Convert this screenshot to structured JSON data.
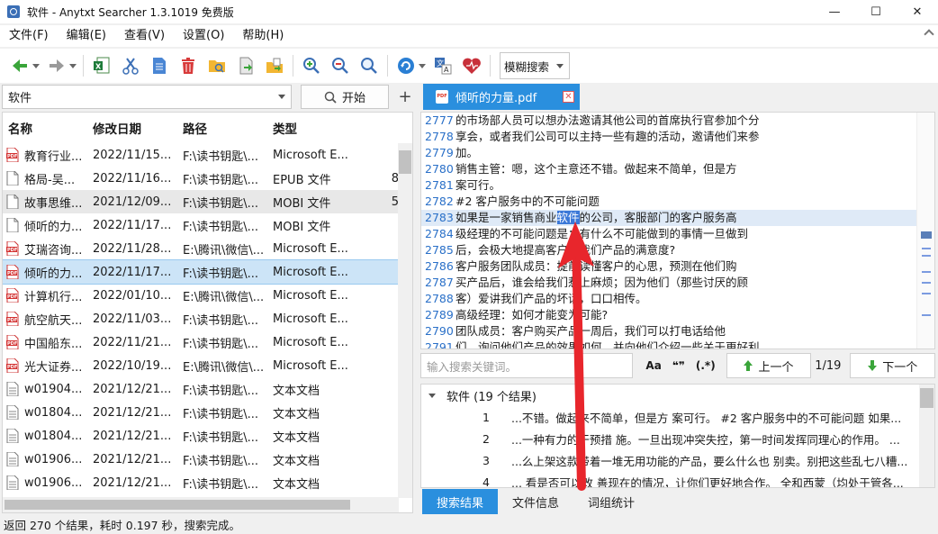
{
  "window": {
    "title": "软件 - Anytxt Searcher 1.3.1019 免费版",
    "minimize": "—",
    "maximize": "☐",
    "close": "✕"
  },
  "menu": [
    "文件(F)",
    "编辑(E)",
    "查看(V)",
    "设置(O)",
    "帮助(H)"
  ],
  "toolbar": {
    "icons": [
      "back-icon",
      "forward-icon",
      "excel-export-icon",
      "cut-icon",
      "document-icon",
      "delete-icon",
      "open-folder-icon",
      "open-file-icon",
      "copy-to-icon",
      "zoom-in-icon",
      "zoom-out-icon",
      "search-icon",
      "refresh-icon",
      "translate-icon",
      "heart-icon"
    ],
    "search_mode": "模糊搜索"
  },
  "search": {
    "query": "软件",
    "start_label": "开始",
    "add_label": "+"
  },
  "list": {
    "headers": {
      "name": "名称",
      "date": "修改日期",
      "path": "路径",
      "type": "类型"
    },
    "rows": [
      {
        "name": "教育行业...",
        "date": "2022/11/15...",
        "path": "F:\\读书钥匙\\...",
        "type": "Microsoft E...",
        "extra": "",
        "icon": "pdf"
      },
      {
        "name": "格局-吴...",
        "date": "2022/11/16...",
        "path": "F:\\读书钥匙\\...",
        "type": "EPUB 文件",
        "extra": "8",
        "icon": "doc"
      },
      {
        "name": "故事思维...",
        "date": "2021/12/09...",
        "path": "F:\\读书钥匙\\...",
        "type": "MOBI 文件",
        "extra": "5",
        "icon": "doc"
      },
      {
        "name": "倾听的力...",
        "date": "2022/11/17...",
        "path": "F:\\读书钥匙\\...",
        "type": "MOBI 文件",
        "extra": "",
        "icon": "doc"
      },
      {
        "name": "艾瑞咨询...",
        "date": "2022/11/28...",
        "path": "E:\\腾讯\\微信\\...",
        "type": "Microsoft E...",
        "extra": "",
        "icon": "pdf"
      },
      {
        "name": "倾听的力...",
        "date": "2022/11/17...",
        "path": "F:\\读书钥匙\\...",
        "type": "Microsoft E...",
        "extra": "",
        "icon": "pdf"
      },
      {
        "name": "计算机行...",
        "date": "2022/01/10...",
        "path": "E:\\腾讯\\微信\\...",
        "type": "Microsoft E...",
        "extra": "",
        "icon": "pdf"
      },
      {
        "name": "航空航天...",
        "date": "2022/11/03...",
        "path": "F:\\读书钥匙\\...",
        "type": "Microsoft E...",
        "extra": "",
        "icon": "pdf"
      },
      {
        "name": "中国船东...",
        "date": "2022/11/21...",
        "path": "F:\\读书钥匙\\...",
        "type": "Microsoft E...",
        "extra": "",
        "icon": "pdf"
      },
      {
        "name": "光大证券...",
        "date": "2022/10/19...",
        "path": "E:\\腾讯\\微信\\...",
        "type": "Microsoft E...",
        "extra": "",
        "icon": "pdf"
      },
      {
        "name": "w01904...",
        "date": "2021/12/21...",
        "path": "F:\\读书钥匙\\...",
        "type": "文本文档",
        "extra": "",
        "icon": "txt"
      },
      {
        "name": "w01804...",
        "date": "2021/12/21...",
        "path": "F:\\读书钥匙\\...",
        "type": "文本文档",
        "extra": "",
        "icon": "txt"
      },
      {
        "name": "w01804...",
        "date": "2021/12/21...",
        "path": "F:\\读书钥匙\\...",
        "type": "文本文档",
        "extra": "",
        "icon": "txt"
      },
      {
        "name": "w01906...",
        "date": "2021/12/21...",
        "path": "F:\\读书钥匙\\...",
        "type": "文本文档",
        "extra": "",
        "icon": "txt"
      },
      {
        "name": "w01906...",
        "date": "2021/12/21...",
        "path": "F:\\读书钥匙\\...",
        "type": "文本文档",
        "extra": "",
        "icon": "txt"
      }
    ]
  },
  "tab": {
    "filename": "倾听的力量.pdf"
  },
  "viewer": {
    "lines": [
      {
        "n": "2777",
        "t": "的市场部人员可以想办法邀请其他公司的首席执行官参加个分"
      },
      {
        "n": "2778",
        "t": "享会，或者我们公司可以主持一些有趣的活动，邀请他们来参"
      },
      {
        "n": "2779",
        "t": "加。"
      },
      {
        "n": "2780",
        "t": "销售主管：嗯，这个主意还不错。做起来不简单，但是方"
      },
      {
        "n": "2781",
        "t": "案可行。"
      },
      {
        "n": "2782",
        "t": "#2 客户服务中的不可能问题"
      },
      {
        "n": "2783",
        "pre": "如果是一家销售商业",
        "hl": "软件",
        "post": "的公司，客服部门的客户服务高"
      },
      {
        "n": "2784",
        "t": "级经理的不可能问题是：有什么不可能做到的事情一旦做到"
      },
      {
        "n": "2785",
        "t": "后，会极大地提高客户对我们产品的满意度?"
      },
      {
        "n": "2786",
        "t": "客户服务团队成员：提前读懂客户的心思，预测在他们购"
      },
      {
        "n": "2787",
        "t": "买产品后，谁会给我们惹上麻烦；因为他们（那些讨厌的顾"
      },
      {
        "n": "2788",
        "t": "客）爱讲我们产品的坏话，口口相传。"
      },
      {
        "n": "2789",
        "t": "高级经理：如何才能变为可能?"
      },
      {
        "n": "2790",
        "t": "团队成员：客户购买产品一周后，我们可以打电话给他"
      },
      {
        "n": "2791",
        "t": "们，询问他们产品的效果如何，并向他们介绍一些关于更好利"
      }
    ]
  },
  "find": {
    "placeholder": "输入搜索关键词。",
    "opt_case": "Aa",
    "opt_word": "❝❞",
    "opt_regex": "(.*)",
    "prev_label": "上一个",
    "count": "1/19",
    "next_label": "下一个"
  },
  "results": {
    "group": "软件 (19 个结果)",
    "rows": [
      {
        "n": "1",
        "t": "...不错。做起来不简单，但是方 案可行。 #2 客户服务中的不可能问题 如果..."
      },
      {
        "n": "2",
        "t": "...一种有力的干预措 施。一旦出现冲突失控，第一时间发挥同理心的作用。 ..."
      },
      {
        "n": "3",
        "t": "...么上架这款带着一堆无用功能的产品，要么什么也 别卖。别把这些乱七八糟..."
      },
      {
        "n": "4",
        "t": "... 看是否可以改 善现在的情况，让你们更好地合作。 全和西蒙（均处于管各..."
      }
    ]
  },
  "bottom_tabs": [
    "搜索结果",
    "文件信息",
    "词组统计"
  ],
  "status": "返回 270 个结果，耗时 0.197 秒，搜索完成。",
  "colors": {
    "accent": "#2a8fde",
    "highlight": "#3b78d8",
    "annotation": "#e8262c"
  }
}
